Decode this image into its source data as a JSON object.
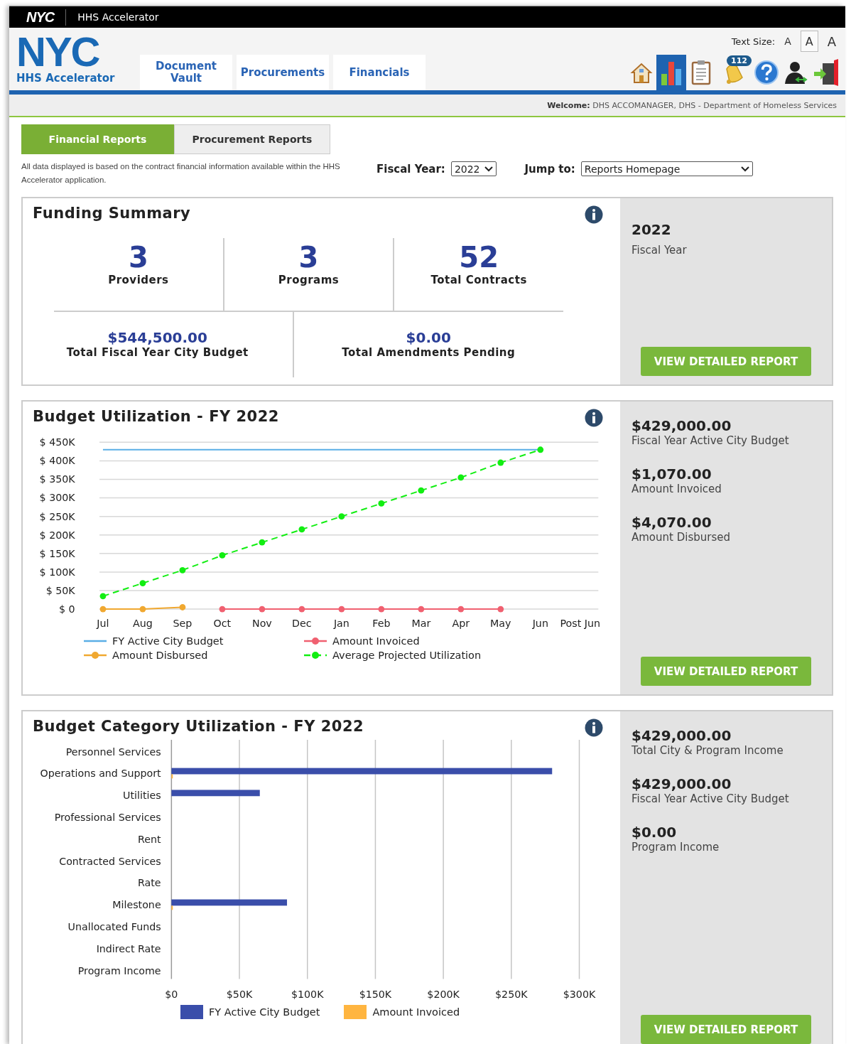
{
  "topbar": {
    "logo": "NYC",
    "title": "HHS Accelerator"
  },
  "header": {
    "logo": "NYC",
    "logo_subtitle": "HHS Accelerator",
    "nav": [
      {
        "label": "Document Vault"
      },
      {
        "label": "Procurements"
      },
      {
        "label": "Financials"
      }
    ],
    "text_size": {
      "label": "Text Size:",
      "options": [
        {
          "label": "A",
          "selected": false
        },
        {
          "label": "A",
          "selected": true
        },
        {
          "label": "A",
          "selected": false
        }
      ]
    },
    "toolbar": [
      {
        "kind": "home",
        "selected": false
      },
      {
        "kind": "reports",
        "selected": true
      },
      {
        "kind": "tasks",
        "selected": false
      },
      {
        "kind": "notifications",
        "selected": false,
        "badge": "112"
      },
      {
        "kind": "help",
        "selected": false
      },
      {
        "kind": "switch_user",
        "selected": false
      },
      {
        "kind": "logout",
        "selected": false
      }
    ]
  },
  "welcome": {
    "label": "Welcome:",
    "user": "DHS ACCOMANAGER,  DHS - Department of Homeless Services"
  },
  "report_tabs": [
    {
      "label": "Financial Reports",
      "selected": true
    },
    {
      "label": "Procurement Reports",
      "selected": false
    }
  ],
  "note": "All data displayed is based on the contract financial information available within the HHS Accelerator application.",
  "fiscal_year": {
    "label": "Fiscal Year:",
    "value": "2022"
  },
  "jump_to": {
    "label": "Jump to:",
    "value": "Reports Homepage"
  },
  "funding_summary": {
    "title": "Funding Summary",
    "stats": [
      {
        "value": "3",
        "label": "Providers"
      },
      {
        "value": "3",
        "label": "Programs"
      },
      {
        "value": "52",
        "label": "Total Contracts"
      }
    ],
    "totals": [
      {
        "value": "$544,500.00",
        "label": "Total Fiscal Year City Budget"
      },
      {
        "value": "$0.00",
        "label": "Total Amendments Pending"
      }
    ],
    "side": {
      "year": "2022",
      "label": "Fiscal Year"
    },
    "button": "VIEW DETAILED REPORT"
  },
  "budget_utilization": {
    "title": "Budget Utilization - FY 2022",
    "chart_data": {
      "type": "line",
      "grid": true,
      "categories": [
        "Jul",
        "Aug",
        "Sep",
        "Oct",
        "Nov",
        "Dec",
        "Jan",
        "Feb",
        "Mar",
        "Apr",
        "May",
        "Jun",
        "Post Jun"
      ],
      "ylim": [
        0,
        450000
      ],
      "yticks": [
        {
          "value": 0,
          "label": "$ 0"
        },
        {
          "value": 50000,
          "label": "$ 50K"
        },
        {
          "value": 100000,
          "label": "$ 100K"
        },
        {
          "value": 150000,
          "label": "$ 150K"
        },
        {
          "value": 200000,
          "label": "$ 200K"
        },
        {
          "value": 250000,
          "label": "$ 250K"
        },
        {
          "value": 300000,
          "label": "$ 300K"
        },
        {
          "value": 350000,
          "label": "$ 350K"
        },
        {
          "value": 400000,
          "label": "$ 400K"
        },
        {
          "value": 450000,
          "label": "$ 450K"
        }
      ],
      "series": [
        {
          "name": "FY Active City Budget",
          "color": "#5aaee6",
          "marker": false,
          "line_style": "solid",
          "values": [
            430000,
            430000,
            430000,
            430000,
            430000,
            430000,
            430000,
            430000,
            430000,
            430000,
            430000,
            430000,
            null
          ]
        },
        {
          "name": "Amount Disbursed",
          "color": "#f0a830",
          "marker": true,
          "line_style": "solid",
          "values": [
            0,
            0,
            5000,
            null,
            null,
            null,
            null,
            null,
            null,
            null,
            null,
            null,
            null
          ]
        },
        {
          "name": "Amount Invoiced",
          "color": "#f06070",
          "marker": true,
          "line_style": "solid",
          "values": [
            null,
            null,
            null,
            0,
            0,
            0,
            0,
            0,
            0,
            0,
            0,
            null,
            null
          ]
        },
        {
          "name": "Average Projected Utilization",
          "color": "#11ee11",
          "marker": true,
          "line_style": "dashed",
          "values": [
            35000,
            70000,
            105000,
            145000,
            180000,
            215000,
            250000,
            285000,
            320000,
            355000,
            395000,
            430000,
            null
          ]
        }
      ]
    },
    "side": [
      {
        "value": "$429,000.00",
        "label": "Fiscal Year Active City Budget"
      },
      {
        "value": "$1,070.00",
        "label": "Amount Invoiced"
      },
      {
        "value": "$4,070.00",
        "label": "Amount Disbursed"
      }
    ],
    "button": "VIEW DETAILED REPORT"
  },
  "category_utilization": {
    "title": "Budget Category Utilization - FY 2022",
    "chart_data": {
      "type": "bar",
      "orientation": "horizontal",
      "grid": true,
      "categories": [
        "Personnel Services",
        "Operations and Support",
        "Utilities",
        "Professional Services",
        "Rent",
        "Contracted Services",
        "Rate",
        "Milestone",
        "Unallocated Funds",
        "Indirect Rate",
        "Program Income"
      ],
      "xlim": [
        0,
        300000
      ],
      "xticks": [
        {
          "value": 0,
          "label": "$0"
        },
        {
          "value": 50000,
          "label": "$50K"
        },
        {
          "value": 100000,
          "label": "$100K"
        },
        {
          "value": 150000,
          "label": "$150K"
        },
        {
          "value": 200000,
          "label": "$200K"
        },
        {
          "value": 250000,
          "label": "$250K"
        },
        {
          "value": 300000,
          "label": "$300K"
        }
      ],
      "series": [
        {
          "name": "FY Active City Budget",
          "color": "#3a4eaa",
          "values": [
            0,
            280000,
            65000,
            0,
            0,
            0,
            0,
            85000,
            0,
            0,
            0
          ]
        },
        {
          "name": "Amount Invoiced",
          "color": "#ffb540",
          "values": [
            0,
            1000,
            0,
            0,
            0,
            0,
            0,
            1000,
            0,
            0,
            0
          ]
        }
      ]
    },
    "side": [
      {
        "value": "$429,000.00",
        "label": "Total City & Program Income"
      },
      {
        "value": "$429,000.00",
        "label": "Fiscal Year Active City Budget"
      },
      {
        "value": "$0.00",
        "label": "Program Income"
      }
    ],
    "button": "VIEW DETAILED REPORT"
  }
}
